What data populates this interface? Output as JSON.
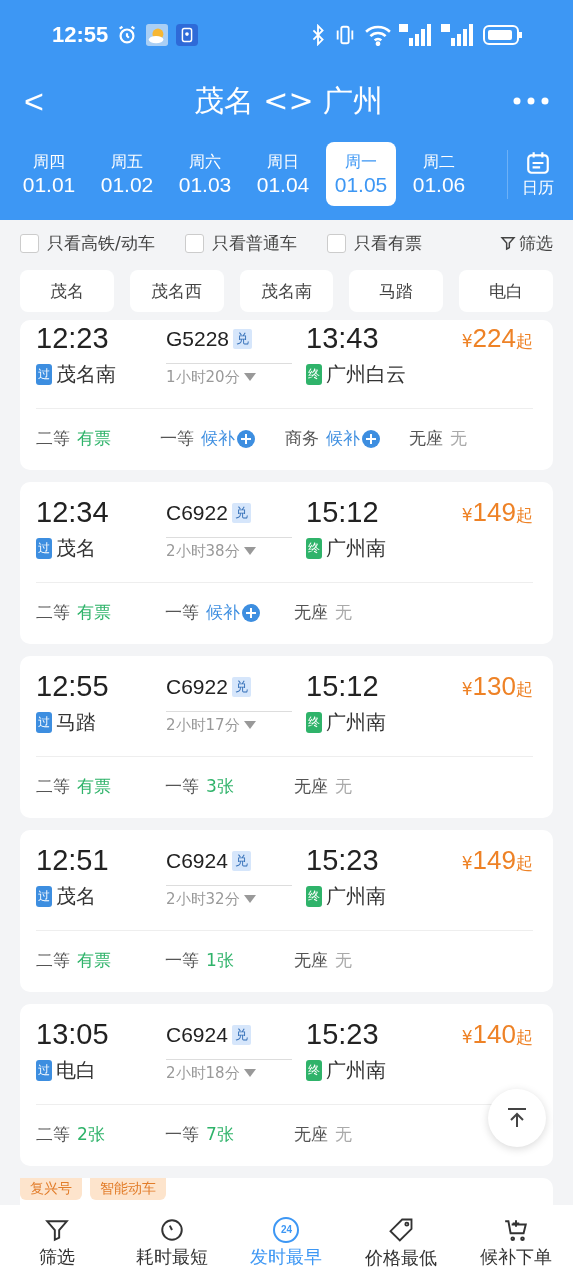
{
  "status_bar": {
    "time": "12:55"
  },
  "header": {
    "back": "<",
    "title": "茂名 <> 广州"
  },
  "dates": [
    {
      "weekday": "周四",
      "date": "01.01",
      "selected": false
    },
    {
      "weekday": "周五",
      "date": "01.02",
      "selected": false
    },
    {
      "weekday": "周六",
      "date": "01.03",
      "selected": false
    },
    {
      "weekday": "周日",
      "date": "01.04",
      "selected": false
    },
    {
      "weekday": "周一",
      "date": "01.05",
      "selected": true
    },
    {
      "weekday": "周二",
      "date": "01.06",
      "selected": false
    }
  ],
  "calendar_label": "日历",
  "filters": [
    {
      "label": "只看高铁/动车",
      "checked": false
    },
    {
      "label": "只看普通车",
      "checked": false
    },
    {
      "label": "只看有票",
      "checked": false
    }
  ],
  "filter_button": "筛选",
  "stations": [
    "茂名",
    "茂名西",
    "茂名南",
    "马踏",
    "电白"
  ],
  "trains": [
    {
      "depart": "12:23",
      "number": "G5228",
      "badge": "兑",
      "arrive": "13:43",
      "price_symbol": "¥",
      "price": "224",
      "price_suffix": "起",
      "from_tag": "过",
      "from": "茂名南",
      "duration": "1小时20分",
      "to_tag": "终",
      "to": "广州白云",
      "seats": [
        {
          "class": "二等",
          "status": "有票",
          "kind": "available"
        },
        {
          "class": "一等",
          "status": "候补",
          "kind": "waitlist"
        },
        {
          "class": "商务",
          "status": "候补",
          "kind": "waitlist"
        },
        {
          "class": "无座",
          "status": "无",
          "kind": "none"
        }
      ]
    },
    {
      "depart": "12:34",
      "number": "C6922",
      "badge": "兑",
      "arrive": "15:12",
      "price_symbol": "¥",
      "price": "149",
      "price_suffix": "起",
      "from_tag": "过",
      "from": "茂名",
      "duration": "2小时38分",
      "to_tag": "终",
      "to": "广州南",
      "seats": [
        {
          "class": "二等",
          "status": "有票",
          "kind": "available"
        },
        {
          "class": "一等",
          "status": "候补",
          "kind": "waitlist"
        },
        {
          "class": "无座",
          "status": "无",
          "kind": "none"
        }
      ]
    },
    {
      "depart": "12:55",
      "number": "C6922",
      "badge": "兑",
      "arrive": "15:12",
      "price_symbol": "¥",
      "price": "130",
      "price_suffix": "起",
      "from_tag": "过",
      "from": "马踏",
      "duration": "2小时17分",
      "to_tag": "终",
      "to": "广州南",
      "seats": [
        {
          "class": "二等",
          "status": "有票",
          "kind": "available"
        },
        {
          "class": "一等",
          "status": "3张",
          "kind": "available"
        },
        {
          "class": "无座",
          "status": "无",
          "kind": "none"
        }
      ]
    },
    {
      "depart": "12:51",
      "number": "C6924",
      "badge": "兑",
      "arrive": "15:23",
      "price_symbol": "¥",
      "price": "149",
      "price_suffix": "起",
      "from_tag": "过",
      "from": "茂名",
      "duration": "2小时32分",
      "to_tag": "终",
      "to": "广州南",
      "seats": [
        {
          "class": "二等",
          "status": "有票",
          "kind": "available"
        },
        {
          "class": "一等",
          "status": "1张",
          "kind": "available"
        },
        {
          "class": "无座",
          "status": "无",
          "kind": "none"
        }
      ]
    },
    {
      "depart": "13:05",
      "number": "C6924",
      "badge": "兑",
      "arrive": "15:23",
      "price_symbol": "¥",
      "price": "140",
      "price_suffix": "起",
      "from_tag": "过",
      "from": "电白",
      "duration": "2小时18分",
      "to_tag": "终",
      "to": "广州南",
      "seats": [
        {
          "class": "二等",
          "status": "2张",
          "kind": "available"
        },
        {
          "class": "一等",
          "status": "7张",
          "kind": "available"
        },
        {
          "class": "无座",
          "status": "无",
          "kind": "none"
        }
      ]
    }
  ],
  "next_card_tags": [
    "复兴号",
    "智能动车"
  ],
  "bottom_nav": [
    {
      "label": "筛选",
      "kind": "filter",
      "selected": false
    },
    {
      "label": "耗时最短",
      "kind": "timer",
      "selected": false
    },
    {
      "label": "发时最早",
      "kind": "clock24",
      "icon_text": "24",
      "selected": true
    },
    {
      "label": "价格最低",
      "kind": "tag",
      "selected": false
    },
    {
      "label": "候补下单",
      "kind": "cart",
      "selected": false
    }
  ]
}
